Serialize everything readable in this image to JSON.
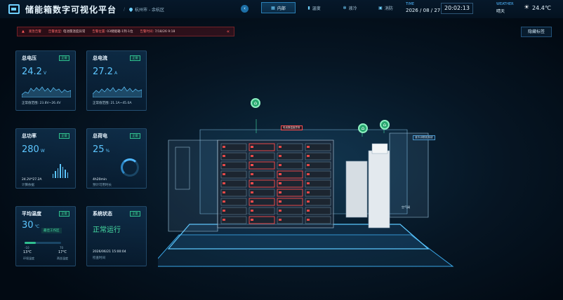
{
  "header": {
    "app_title": "储能箱数字可视化平台",
    "location": "杭州市 - 余杭区",
    "collapse_icon": "chevron-left-icon",
    "tabs": [
      {
        "label": "内部",
        "icon": "grid-icon",
        "active": true
      },
      {
        "label": "温度",
        "icon": "thermometer-icon",
        "active": false
      },
      {
        "label": "液冷",
        "icon": "snowflake-icon",
        "active": false
      },
      {
        "label": "消防",
        "icon": "extinguisher-icon",
        "active": false
      }
    ],
    "time_label": "TIME",
    "date": "2026 / 08 / 27",
    "clock": "20:02:13",
    "weather_label": "WEATHER",
    "weather": "晴天",
    "temperature": "24.4℃"
  },
  "alert": {
    "tag": "紧急告警",
    "type_label": "告警类型:",
    "type_value": "电池簇温度异常",
    "location_label": "告警位置:",
    "location_value": "03储能箱-1列-1位",
    "time_label": "告警时间:",
    "time_value": "7/18/26 9:18"
  },
  "hide_button": "隐藏标签",
  "cards": {
    "voltage": {
      "title": "总电压",
      "badge": "正常",
      "value": "24.2",
      "unit": "V",
      "note": "正常值范围: 23.8V~26.4V"
    },
    "current": {
      "title": "总电流",
      "badge": "正常",
      "value": "27.2",
      "unit": "A",
      "note": "正常值范围: 21.1A~45.0A"
    },
    "power": {
      "title": "总功率",
      "badge": "正常",
      "value": "280",
      "unit": "W",
      "note": "24.2V*27.2A",
      "note2": "计算依据"
    },
    "soc": {
      "title": "总荷电",
      "badge": "正常",
      "value": "25",
      "unit": "%",
      "note": "4h20min",
      "note2": "预计可用时长"
    },
    "temp": {
      "title": "平均温度",
      "badge": "正常",
      "value": "30",
      "unit": "℃",
      "chip": "最佳工作区",
      "range_min": "-10",
      "range_max": "70",
      "env_temp": "13℃",
      "env_label": "环境温度",
      "dual_temp": "17℃",
      "dual_label": "两坐温度"
    },
    "status": {
      "title": "系统状态",
      "badge": "正常",
      "status": "正常运行",
      "note": "2026/06/21 15:00:04",
      "note2": "检查时间"
    }
  },
  "scene": {
    "label_battery": "电池簇温度异常",
    "label_fire": "液冷/消防柜系统",
    "label_air": "空气阀",
    "markers": 3
  }
}
